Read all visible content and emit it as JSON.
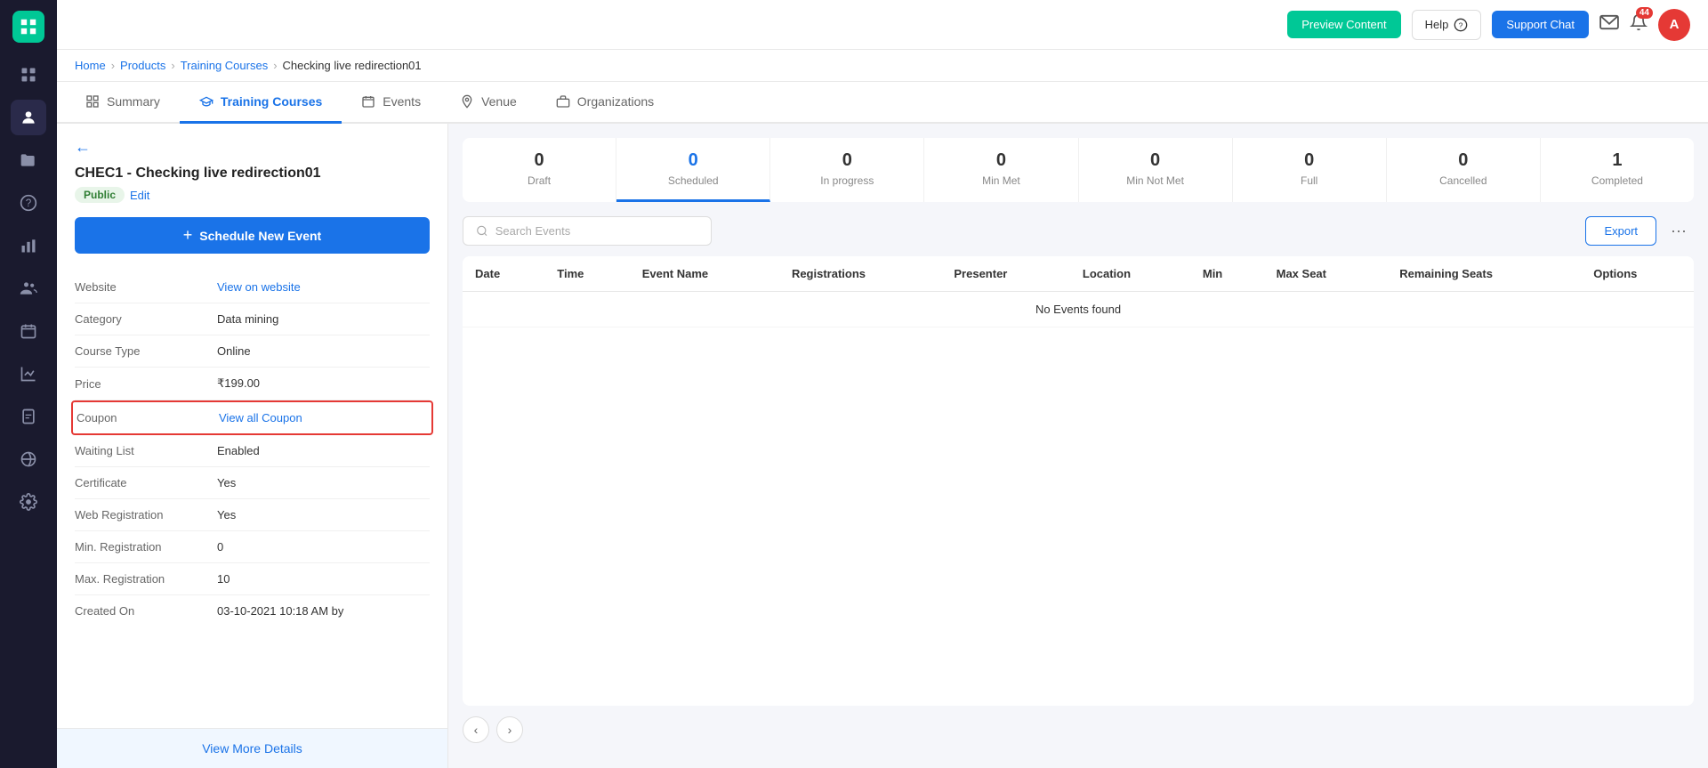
{
  "sidebar": {
    "logo": "≡",
    "icons": [
      "grid",
      "graduation",
      "folder",
      "question",
      "chart",
      "person",
      "calendar",
      "bar-chart",
      "clipboard",
      "globe",
      "settings"
    ]
  },
  "header": {
    "preview_label": "Preview Content",
    "help_label": "Help",
    "support_label": "Support Chat",
    "notification_count": "44",
    "avatar_letter": "A"
  },
  "breadcrumb": {
    "items": [
      "Home",
      "Products",
      "Training Courses",
      "Checking live redirection01"
    ]
  },
  "tabs": [
    {
      "id": "summary",
      "label": "Summary",
      "active": false
    },
    {
      "id": "training-courses",
      "label": "Training Courses",
      "active": true
    },
    {
      "id": "events",
      "label": "Events",
      "active": false
    },
    {
      "id": "venue",
      "label": "Venue",
      "active": false
    },
    {
      "id": "organizations",
      "label": "Organizations",
      "active": false
    }
  ],
  "course": {
    "code": "CHEC1",
    "name": "Checking live redirection01",
    "title": "CHEC1 - Checking live redirection01",
    "status": "Public",
    "edit_label": "Edit",
    "schedule_btn": "Schedule New Event",
    "back_arrow": "←"
  },
  "info_fields": [
    {
      "label": "Website",
      "value": "View on website",
      "is_link": true
    },
    {
      "label": "Category",
      "value": "Data mining",
      "is_link": false
    },
    {
      "label": "Course Type",
      "value": "Online",
      "is_link": false
    },
    {
      "label": "Price",
      "value": "₹199.00",
      "is_link": false
    },
    {
      "label": "Coupon",
      "value": "View all Coupon",
      "is_link": true,
      "highlight": true
    },
    {
      "label": "Waiting List",
      "value": "Enabled",
      "is_link": false
    },
    {
      "label": "Certificate",
      "value": "Yes",
      "is_link": false
    },
    {
      "label": "Web Registration",
      "value": "Yes",
      "is_link": false
    },
    {
      "label": "Min. Registration",
      "value": "0",
      "is_link": false
    },
    {
      "label": "Max. Registration",
      "value": "10",
      "is_link": false
    },
    {
      "label": "Created On",
      "value": "03-10-2021 10:18 AM by",
      "is_link": false
    }
  ],
  "view_more_label": "View More Details",
  "stats": [
    {
      "id": "draft",
      "number": "0",
      "label": "Draft",
      "blue": false,
      "active": false
    },
    {
      "id": "scheduled",
      "number": "0",
      "label": "Scheduled",
      "blue": true,
      "active": true
    },
    {
      "id": "in-progress",
      "number": "0",
      "label": "In progress",
      "blue": false,
      "active": false
    },
    {
      "id": "min-met",
      "number": "0",
      "label": "Min Met",
      "blue": false,
      "active": false
    },
    {
      "id": "min-not-met",
      "number": "0",
      "label": "Min Not Met",
      "blue": false,
      "active": false
    },
    {
      "id": "full",
      "number": "0",
      "label": "Full",
      "blue": false,
      "active": false
    },
    {
      "id": "cancelled",
      "number": "0",
      "label": "Cancelled",
      "blue": false,
      "active": false
    },
    {
      "id": "completed",
      "number": "1",
      "label": "Completed",
      "blue": false,
      "active": false
    }
  ],
  "search": {
    "placeholder": "Search Events"
  },
  "export_label": "Export",
  "more_label": "···",
  "table": {
    "columns": [
      "Date",
      "Time",
      "Event Name",
      "Registrations",
      "Presenter",
      "Location",
      "Min",
      "Max Seat",
      "Remaining Seats",
      "Options"
    ],
    "rows": [],
    "empty_message": "No Events found"
  },
  "pagination": {
    "prev": "‹",
    "next": "›"
  }
}
